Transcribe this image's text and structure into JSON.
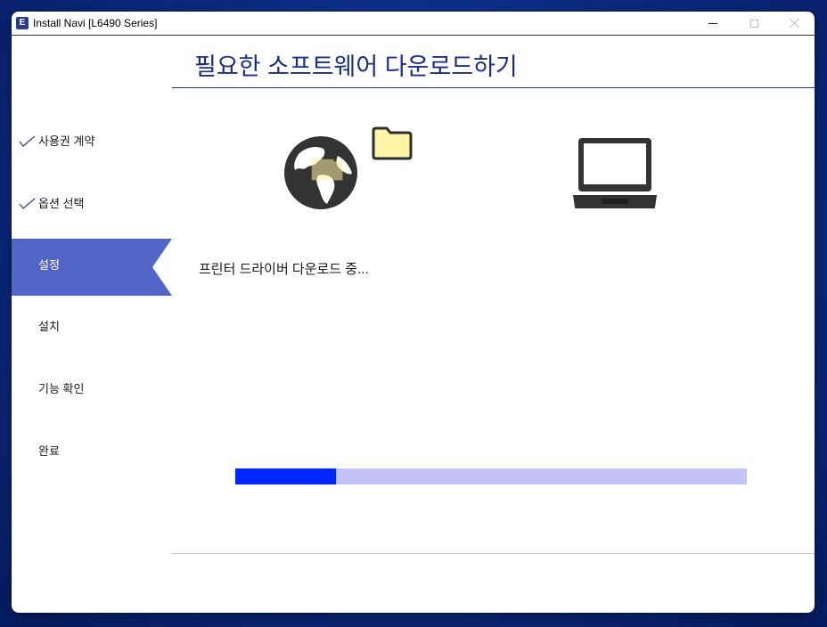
{
  "window": {
    "app_icon_letter": "E",
    "title": "Install Navi [L6490 Series]"
  },
  "sidebar": {
    "steps": [
      {
        "label": "사용권 계약",
        "state": "done"
      },
      {
        "label": "옵션 선택",
        "state": "done"
      },
      {
        "label": "설정",
        "state": "current"
      },
      {
        "label": "설치",
        "state": "pending"
      },
      {
        "label": "기능 확인",
        "state": "pending"
      },
      {
        "label": "완료",
        "state": "pending"
      }
    ]
  },
  "main": {
    "title": "필요한 소프트웨어 다운로드하기",
    "status": "프린터 드라이버 다운로드 중...",
    "progress_percent": 19.6
  },
  "icons": [
    "globe-icon",
    "folder-icon",
    "laptop-icon",
    "checkmark-icon"
  ],
  "colors": {
    "accent": "#5264c6",
    "title": "#1c2f86",
    "progress_fill": "#0026ff",
    "progress_track": "#c3c3f7",
    "folder": "#fff4a6"
  }
}
